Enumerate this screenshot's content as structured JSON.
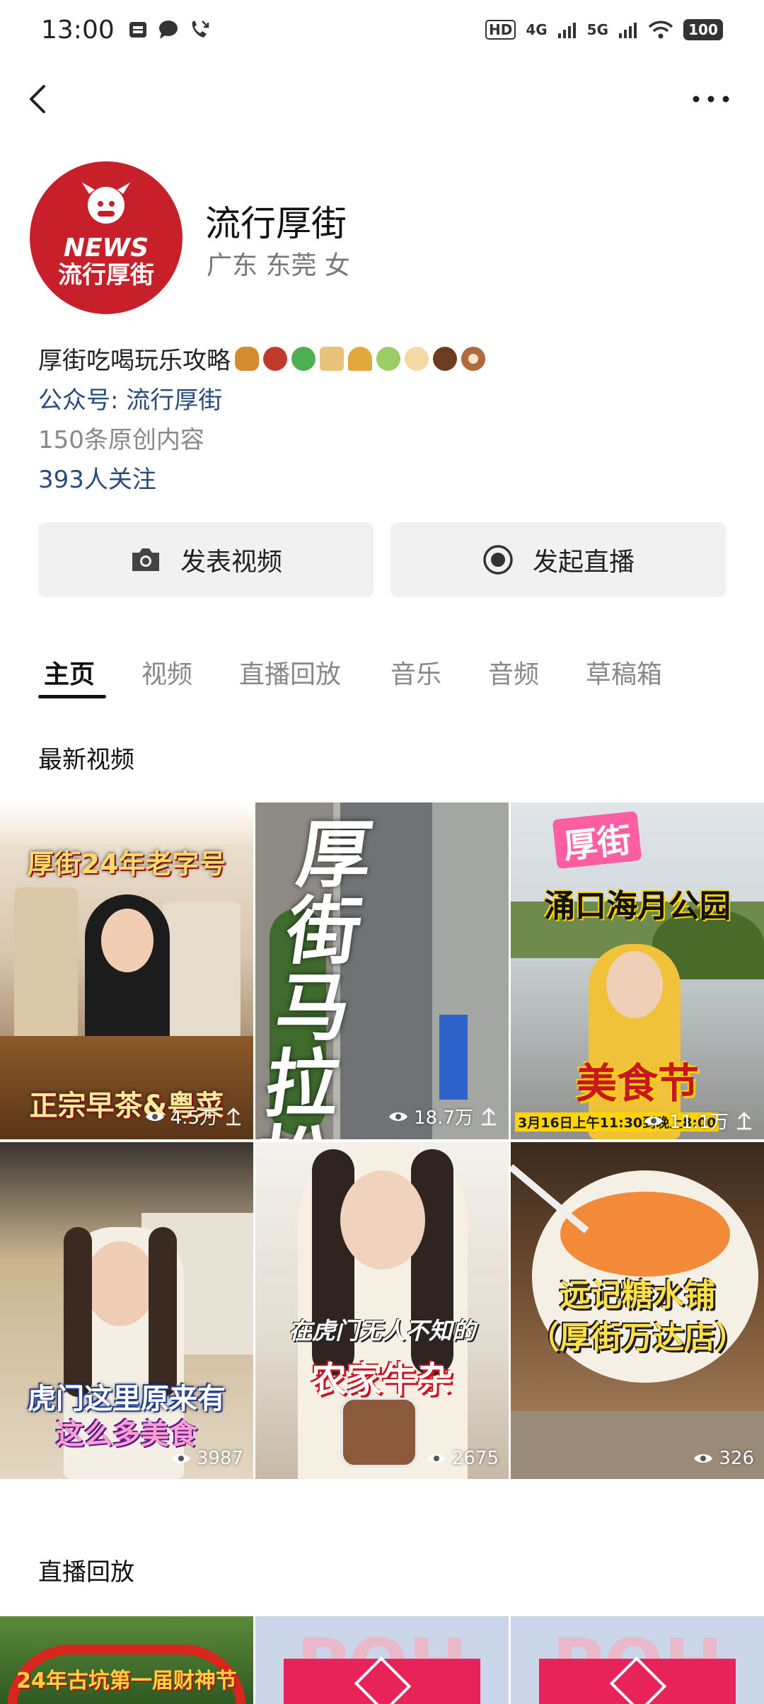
{
  "status": {
    "time": "13:00",
    "network1": "4G",
    "network2": "5G",
    "hd": "HD",
    "battery": "100"
  },
  "profile": {
    "name": "流行厚街",
    "location": "广东 东莞 女",
    "avatar_text_top": "NEWS",
    "avatar_text_bottom": "流行厚街",
    "bio": "厚街吃喝玩乐攻略",
    "official_account": "公众号: 流行厚街",
    "original_count": "150条原创内容",
    "followers": "393人关注"
  },
  "actions": {
    "post_video": "发表视频",
    "start_live": "发起直播"
  },
  "tabs": [
    {
      "label": "主页",
      "active": true
    },
    {
      "label": "视频"
    },
    {
      "label": "直播回放"
    },
    {
      "label": "音乐"
    },
    {
      "label": "音频"
    },
    {
      "label": "草稿箱"
    }
  ],
  "sections": {
    "latest_videos": "最新视频",
    "live_replays": "直播回放"
  },
  "videos": [
    {
      "title_top": "厚街24年老字号",
      "title_bottom": "正宗早茶&粤菜",
      "views": "4.5万",
      "pinned": true
    },
    {
      "title_top": "厚街马拉松",
      "title_bottom": "",
      "views": "18.7万",
      "pinned": true
    },
    {
      "title_top": "厚街",
      "title_mid": "涌口海月公园",
      "title_bottom": "美食节",
      "subtitle": "3月16日上午11:30到晚上8:00",
      "views": "11.1万",
      "pinned": true
    },
    {
      "title_top": "虎门这里原来有",
      "title_bottom": "这么多美食",
      "views": "3987"
    },
    {
      "title_top": "在虎门无人不知的",
      "title_bottom": "农家牛杂",
      "views": "2675"
    },
    {
      "title_top": "远记糖水铺",
      "title_bottom": "（厚街万达店）",
      "views": "326"
    }
  ],
  "live_replays": [
    {
      "text": "24年古坑第一届财神节"
    },
    {
      "text": "POH"
    },
    {
      "text": "POH"
    }
  ],
  "colors": {
    "link": "#2a4c7d",
    "muted": "#888888",
    "button_bg": "#f1f1f1"
  }
}
